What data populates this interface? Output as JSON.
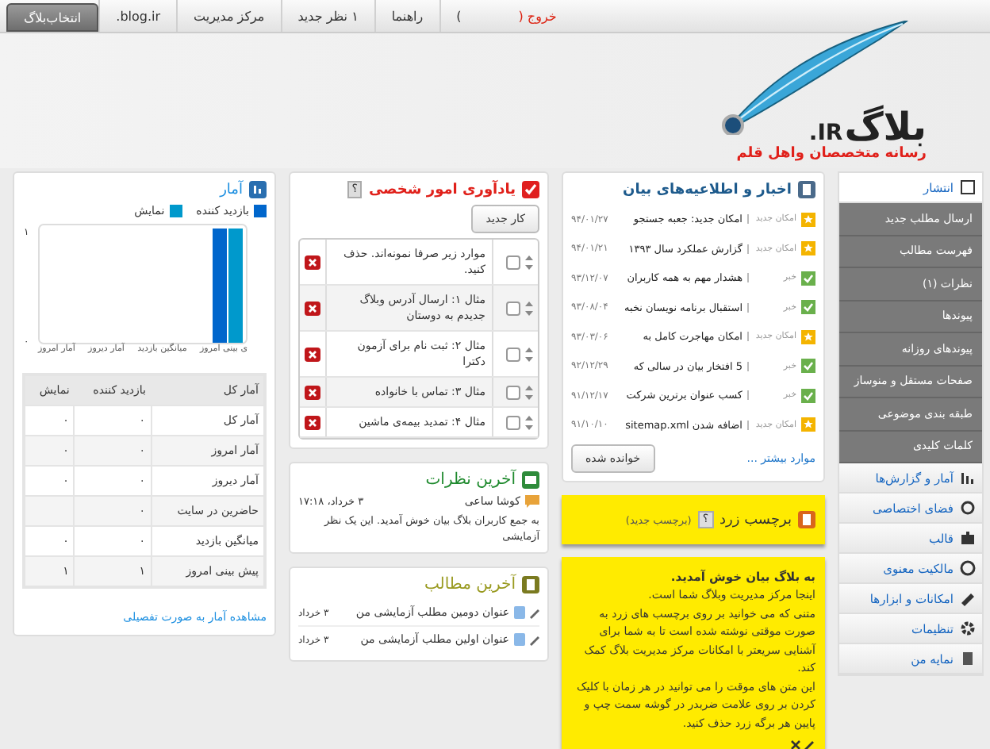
{
  "topbar": {
    "logout": "خروج (",
    "logout_close": ")",
    "tabs": [
      {
        "label": "راهنما",
        "selected": false
      },
      {
        "label": "۱ نظر جدید",
        "selected": false
      },
      {
        "label": "مرکز مدیریت",
        "selected": false
      },
      {
        "label": ".blog.ir",
        "selected": false
      },
      {
        "label": "انتخاب‌بلاگ",
        "selected": true
      }
    ]
  },
  "logo": {
    "name": "بلاگ",
    "domain": ".IR",
    "slogan": "رسانه متخصصان واهل قلم"
  },
  "sidebar": [
    {
      "label": "انتشار",
      "expanded": true,
      "children": [
        {
          "label": "ارسال مطلب جدید"
        },
        {
          "label": "فهرست مطالب"
        },
        {
          "label": "نظرات (۱)"
        },
        {
          "label": "پیوندها"
        },
        {
          "label": "پیوندهای روزانه"
        },
        {
          "label": "صفحات مستقل و منوساز"
        },
        {
          "label": "طبقه بندی موضوعی"
        },
        {
          "label": "کلمات کلیدی"
        }
      ]
    },
    {
      "label": "آمار و گزارش‌ها",
      "expanded": false
    },
    {
      "label": "فضای اختصاصی",
      "expanded": false
    },
    {
      "label": "قالب",
      "expanded": false
    },
    {
      "label": "مالکیت معنوی",
      "expanded": false
    },
    {
      "label": "امکانات و ابزارها",
      "expanded": false
    },
    {
      "label": "تنظیمات",
      "expanded": false
    },
    {
      "label": "نمایه من",
      "expanded": false
    }
  ],
  "news": {
    "title": "اخبار و اطلاعیه‌های بیان",
    "items": [
      {
        "kind": "feature",
        "tag": "امکان جدید",
        "title": "امکان جدید: جعبه جستجو",
        "date": "۹۴/۰۱/۲۷"
      },
      {
        "kind": "feature",
        "tag": "امکان جدید",
        "title": "گزارش عملکرد سال ۱۳۹۳",
        "date": "۹۴/۰۱/۲۱"
      },
      {
        "kind": "news",
        "tag": "خبر",
        "title": "هشدار مهم به همه کاربران",
        "date": "۹۳/۱۲/۰۷"
      },
      {
        "kind": "news",
        "tag": "خبر",
        "title": "استقبال برنامه نویسان نخبه",
        "date": "۹۳/۰۸/۰۴"
      },
      {
        "kind": "feature",
        "tag": "امکان جدید",
        "title": "امکان مهاجرت کامل به",
        "date": "۹۳/۰۳/۰۶"
      },
      {
        "kind": "news",
        "tag": "خبر",
        "title": "5 افتخار بیان در سالی که",
        "date": "۹۲/۱۲/۲۹"
      },
      {
        "kind": "news",
        "tag": "خبر",
        "title": "کسب عنوان برترین شرکت",
        "date": "۹۱/۱۲/۱۷"
      },
      {
        "kind": "feature",
        "tag": "امکان جدید",
        "title": "اضافه شدن sitemap.xml",
        "date": "۹۱/۱۰/۱۰"
      }
    ],
    "more": "موارد بیشتر ...",
    "read_button": "خوانده شده"
  },
  "sticky": {
    "title": "برچسب زرد",
    "help": "؟",
    "new": "(برچسب جدید)"
  },
  "note": {
    "title": "به بلاگ بیان خوش آمدید.",
    "paragraphs": [
      "اینجا مرکز مدیریت وبلاگ شما است.",
      "متنی که می خوانید بر روی برچسب های زرد به صورت موقتی نوشته شده است تا به شما برای آشنایی سریعتر با امکانات مرکز مدیریت بلاگ کمک کند.",
      "این متن های موقت را می توانید در هر زمان با کلیک کردن بر روی علامت ضربدر در گوشه سمت چپ و پایین هر برگه زرد حذف کنید."
    ]
  },
  "todo": {
    "title": "یادآوری امور شخصی",
    "help": "؟",
    "new_button": "کار جدید",
    "items": [
      {
        "text": "موارد زیر صرفا نمونه‌اند. حذف کنید.",
        "checked": false
      },
      {
        "text": "مثال ۱: ارسال آدرس وبلاگ جدیدم به دوستان",
        "checked": false
      },
      {
        "text": "مثال ۲: ثبت نام برای آزمون دکترا",
        "checked": false
      },
      {
        "text": "مثال ۳: تماس با خانواده",
        "checked": false
      },
      {
        "text": "مثال ۴: تمدید بیمه‌ی ماشین",
        "checked": false
      }
    ]
  },
  "comments": {
    "title": "آخرین نظرات",
    "items": [
      {
        "author": "کوشا ساعی",
        "date": "۳ خرداد، ۱۷:۱۸",
        "text": "به جمع کاربران بلاگ بیان خوش آمدید. این یک نظر آزمایشی"
      }
    ]
  },
  "posts": {
    "title": "آخرین مطالب",
    "items": [
      {
        "title": "عنوان دومین مطلب آزمایشی من",
        "date": "۳ خرداد"
      },
      {
        "title": "عنوان اولین مطلب آزمایشی من",
        "date": "۳ خرداد"
      }
    ]
  },
  "stats": {
    "title": "آمار",
    "chart_data": {
      "type": "bar",
      "categories": [
        "آمار امروز",
        "آمار دیروز",
        "میانگین بازدید",
        "ی بینی امروز"
      ],
      "yticks": [
        {
          "value": 1,
          "label": "۱"
        },
        {
          "value": 0,
          "label": "۰"
        }
      ],
      "ylim": [
        0,
        1
      ],
      "series": [
        {
          "name": "بازدید کننده",
          "color": "#0066cc",
          "values": [
            0,
            0,
            0,
            1
          ]
        },
        {
          "name": "نمایش",
          "color": "#0099cc",
          "values": [
            0,
            0,
            0,
            1
          ]
        }
      ]
    },
    "table": {
      "columns": [
        "آمار کل",
        "بازدید کننده",
        "نمایش"
      ],
      "rows": [
        [
          "آمار کل",
          "۰",
          "۰"
        ],
        [
          "آمار امروز",
          "۰",
          "۰"
        ],
        [
          "آمار دیروز",
          "۰",
          "۰"
        ],
        [
          "حاضرین در سایت",
          "۰",
          ""
        ],
        [
          "میانگین بازدید",
          "۰",
          "۰"
        ],
        [
          "پیش بینی امروز",
          "۱",
          "۱"
        ]
      ]
    },
    "details_link": "مشاهده آمار به صورت تفصیلی"
  }
}
